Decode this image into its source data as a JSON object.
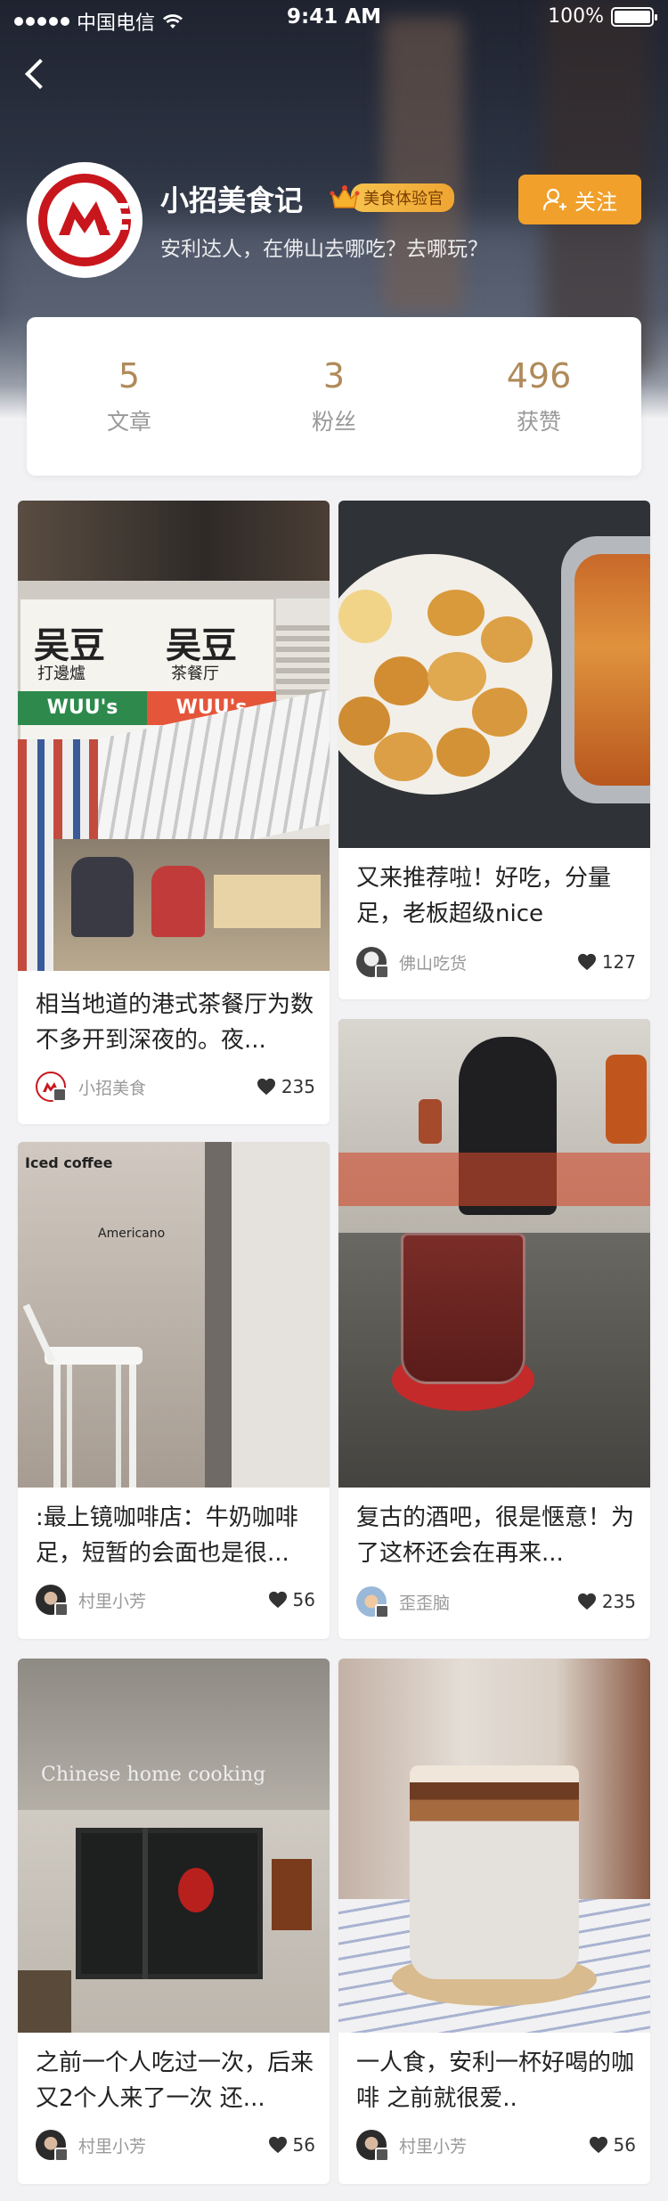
{
  "status_bar": {
    "carrier": "中国电信",
    "time": "9:41 AM",
    "battery": "100%"
  },
  "profile": {
    "name": "小招美食记",
    "badge": "美食体验官",
    "description": "安利达人，在佛山去哪吃？去哪玩？",
    "follow_label": "关注"
  },
  "stats": [
    {
      "value": "5",
      "label": "文章"
    },
    {
      "value": "3",
      "label": "粉丝"
    },
    {
      "value": "496",
      "label": "获赞"
    }
  ],
  "cards": [
    {
      "title": "相当地道的港式茶餐厅为数不多开到深夜的。夜...",
      "author": "小招美食",
      "likes": "235"
    },
    {
      "title": "又来推荐啦！好吃，分量足，老板超级nice",
      "author": "佛山吃货",
      "likes": "127"
    },
    {
      "title": ":最上镜咖啡店：牛奶咖啡足，短暂的会面也是很...",
      "author": "村里小芳",
      "likes": "56"
    },
    {
      "title": "复古的酒吧，很是惬意！为了这杯还会在再来...",
      "author": "歪歪脑",
      "likes": "235"
    },
    {
      "title": "之前一个人吃过一次，后来又2个人来了一次  还...",
      "author": "村里小芳",
      "likes": "56"
    },
    {
      "title": "一人食，安利一杯好喝的咖啡 之前就很爱..",
      "author": "村里小芳",
      "likes": "56"
    }
  ],
  "photo_text": {
    "shop_sign_1": "吴豆",
    "shop_sign_1_sub": "打邊爐",
    "shop_sign_2": "吴豆",
    "shop_sign_2_sub": "茶餐厅",
    "shop_brand": "WUU's",
    "cafe_menu": "Iced coffee",
    "cafe_menu_2": "Americano",
    "home_sign": "Chinese home cooking"
  },
  "colors": {
    "accent": "#f0a02b",
    "stat_value": "#b08a5a",
    "logo_red": "#c8161d"
  }
}
